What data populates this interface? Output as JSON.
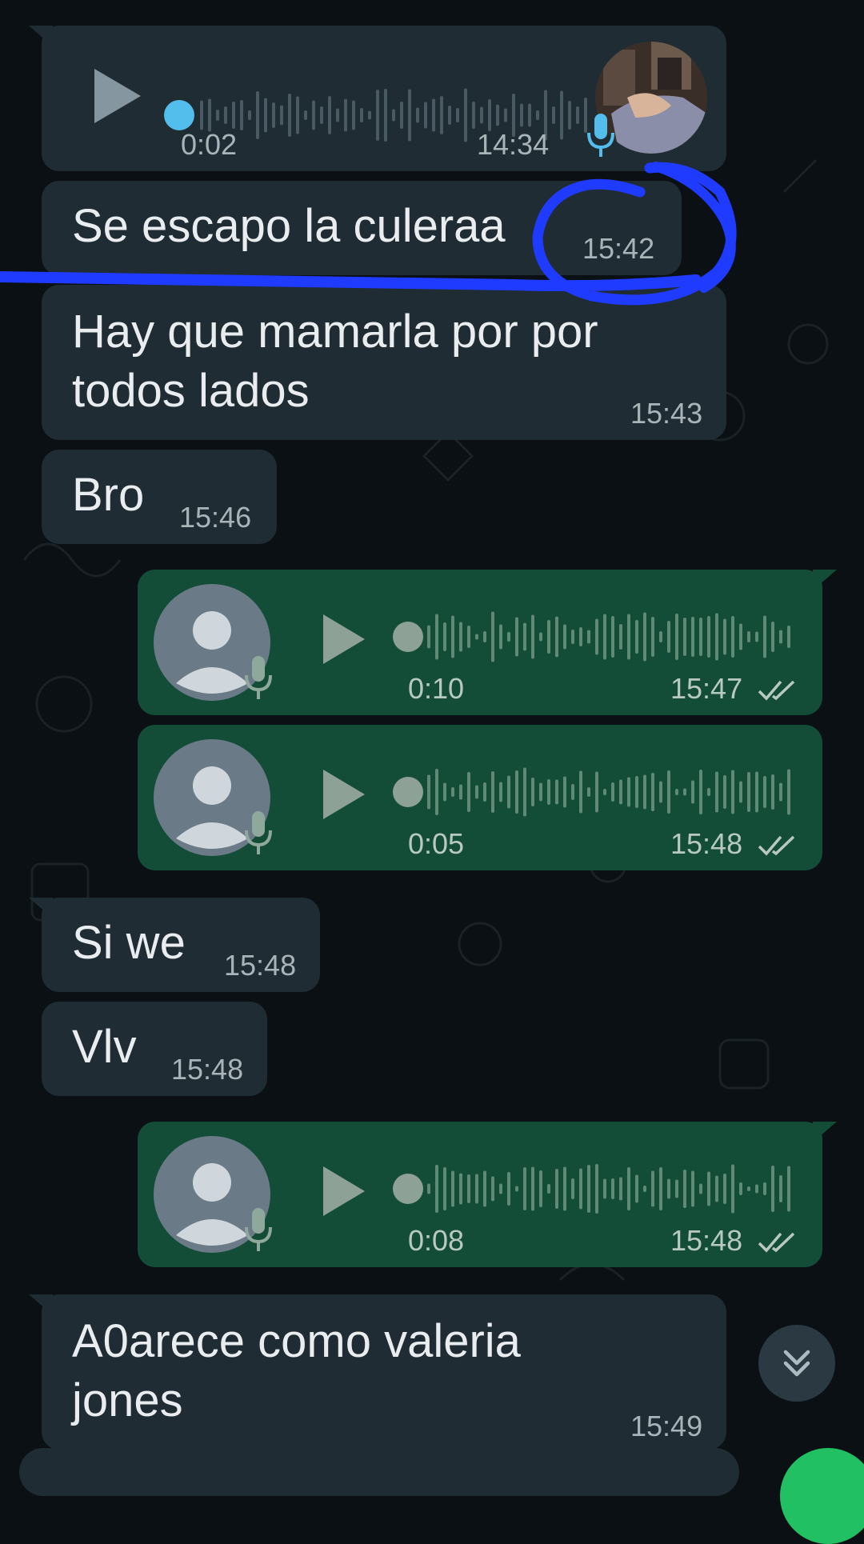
{
  "messages": [
    {
      "id": "m1",
      "type": "voice",
      "dir": "in",
      "duration": "0:02",
      "time": "14:34"
    },
    {
      "id": "m2",
      "type": "text",
      "dir": "in",
      "text": "Se escapo la culeraa",
      "time": "15:42"
    },
    {
      "id": "m3",
      "type": "text",
      "dir": "in",
      "line1": "Hay que mamarla por por",
      "line2": "todos lados",
      "time": "15:43"
    },
    {
      "id": "m4",
      "type": "text",
      "dir": "in",
      "text": "Bro",
      "time": "15:46"
    },
    {
      "id": "m5",
      "type": "voice",
      "dir": "out",
      "duration": "0:10",
      "time": "15:47"
    },
    {
      "id": "m6",
      "type": "voice",
      "dir": "out",
      "duration": "0:05",
      "time": "15:48"
    },
    {
      "id": "m7",
      "type": "text",
      "dir": "in",
      "text": "Si we",
      "time": "15:48"
    },
    {
      "id": "m8",
      "type": "text",
      "dir": "in",
      "text": "Vlv",
      "time": "15:48"
    },
    {
      "id": "m9",
      "type": "voice",
      "dir": "out",
      "duration": "0:08",
      "time": "15:48"
    },
    {
      "id": "m10",
      "type": "text",
      "dir": "in",
      "line1": "A0arece como valeria",
      "line2": "jones",
      "time": "15:49"
    }
  ],
  "colors": {
    "background": "#0b1014",
    "incoming_bubble": "#202c33",
    "outgoing_bubble": "#144d37",
    "playback_dot": "#53bdeb",
    "annotation": "#1f3bff",
    "fab": "#21c063"
  },
  "icons": [
    "play-icon",
    "mic-icon",
    "double-check-icon",
    "default-avatar-icon",
    "chevrons-down-icon"
  ]
}
